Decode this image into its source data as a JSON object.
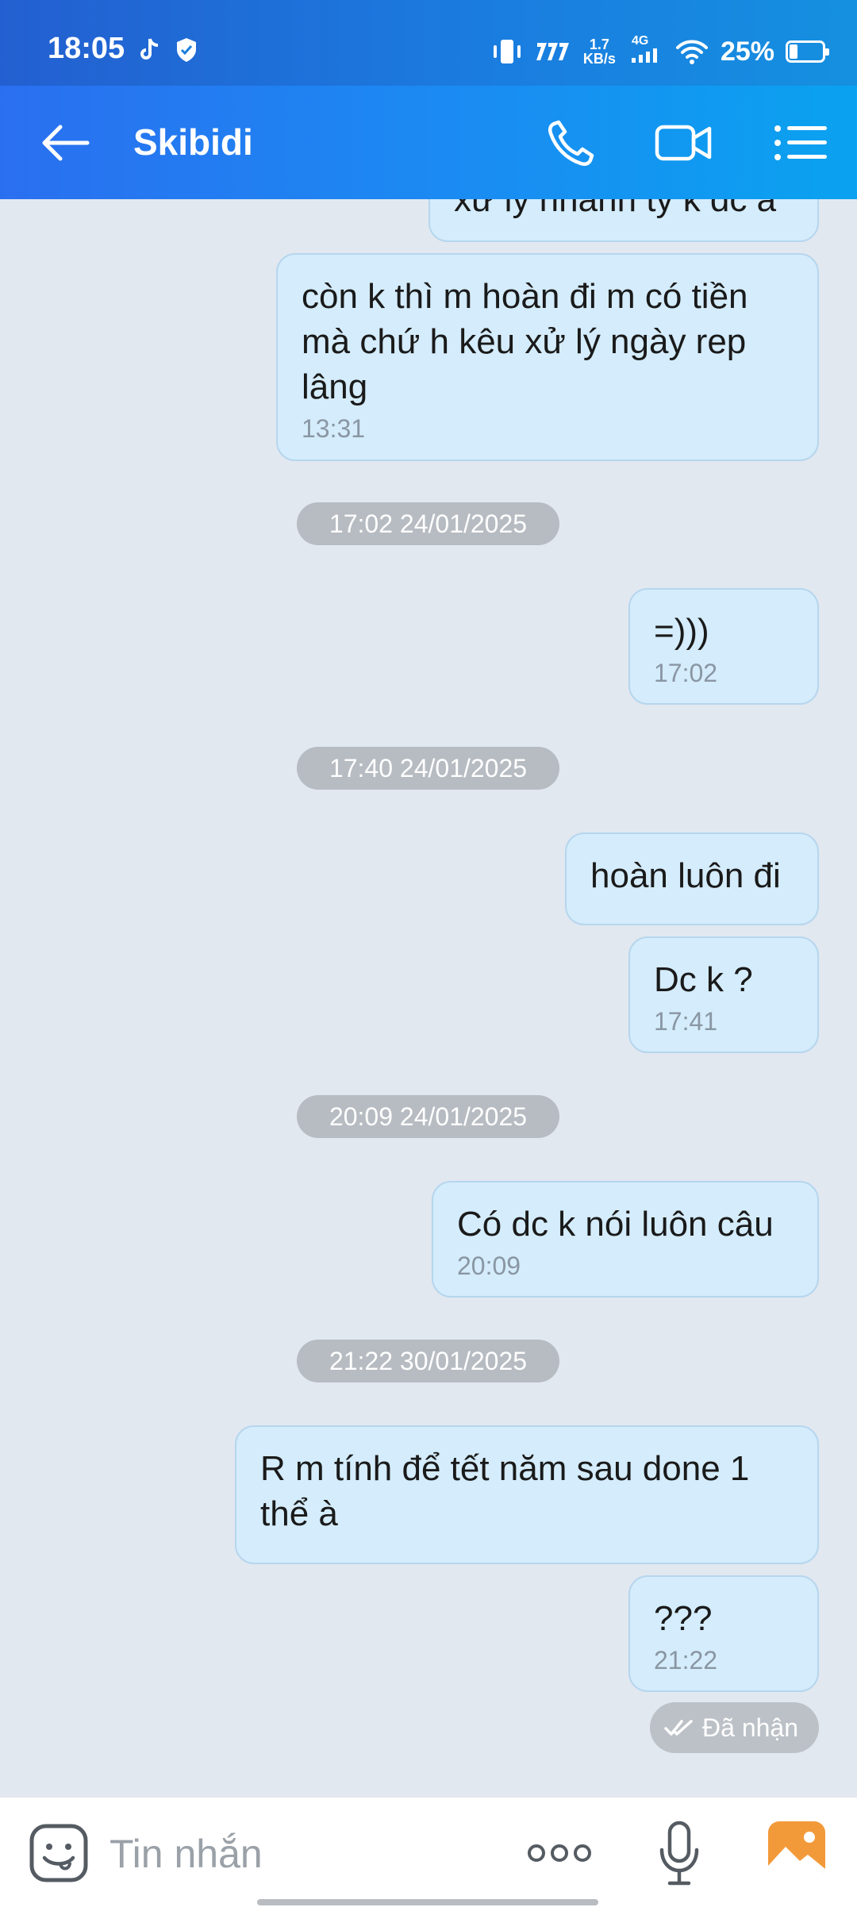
{
  "status_bar": {
    "time": "18:05",
    "speed_value": "1.7",
    "speed_unit": "KB/s",
    "network": "4G",
    "battery_percent": "25%",
    "battery_level": 0.25
  },
  "header": {
    "title": "Skibidi",
    "back_icon": "arrow-left-icon",
    "call_icon": "phone-icon",
    "video_icon": "video-camera-icon",
    "menu_icon": "list-menu-icon"
  },
  "messages": [
    {
      "text": "xử lý nhanh tý k dc à",
      "time": ""
    },
    {
      "text": "còn k thì m hoàn đi m có tiền mà chứ h kêu xử lý ngày rep lâng",
      "time": "13:31"
    },
    {
      "text": "=)))",
      "time": "17:02"
    },
    {
      "text": "hoàn luôn đi",
      "time": ""
    },
    {
      "text": "Dc k ?",
      "time": "17:41"
    },
    {
      "text": "Có dc k nói luôn câu",
      "time": "20:09"
    },
    {
      "text": "R m tính để tết năm sau done 1 thể à",
      "time": ""
    },
    {
      "text": "???",
      "time": "21:22"
    }
  ],
  "date_separators": [
    "17:02 24/01/2025",
    "17:40 24/01/2025",
    "20:09 24/01/2025",
    "21:22 30/01/2025"
  ],
  "delivery_status": "Đã nhận",
  "input": {
    "placeholder": "Tin nhắn",
    "value": ""
  },
  "colors": {
    "header_gradient_start": "#2a6ff0",
    "header_gradient_end": "#0aa2f0",
    "bubble_bg": "#d4ecfb",
    "chat_bg": "#e2e8f0",
    "gallery_icon": "#f29a3a"
  }
}
